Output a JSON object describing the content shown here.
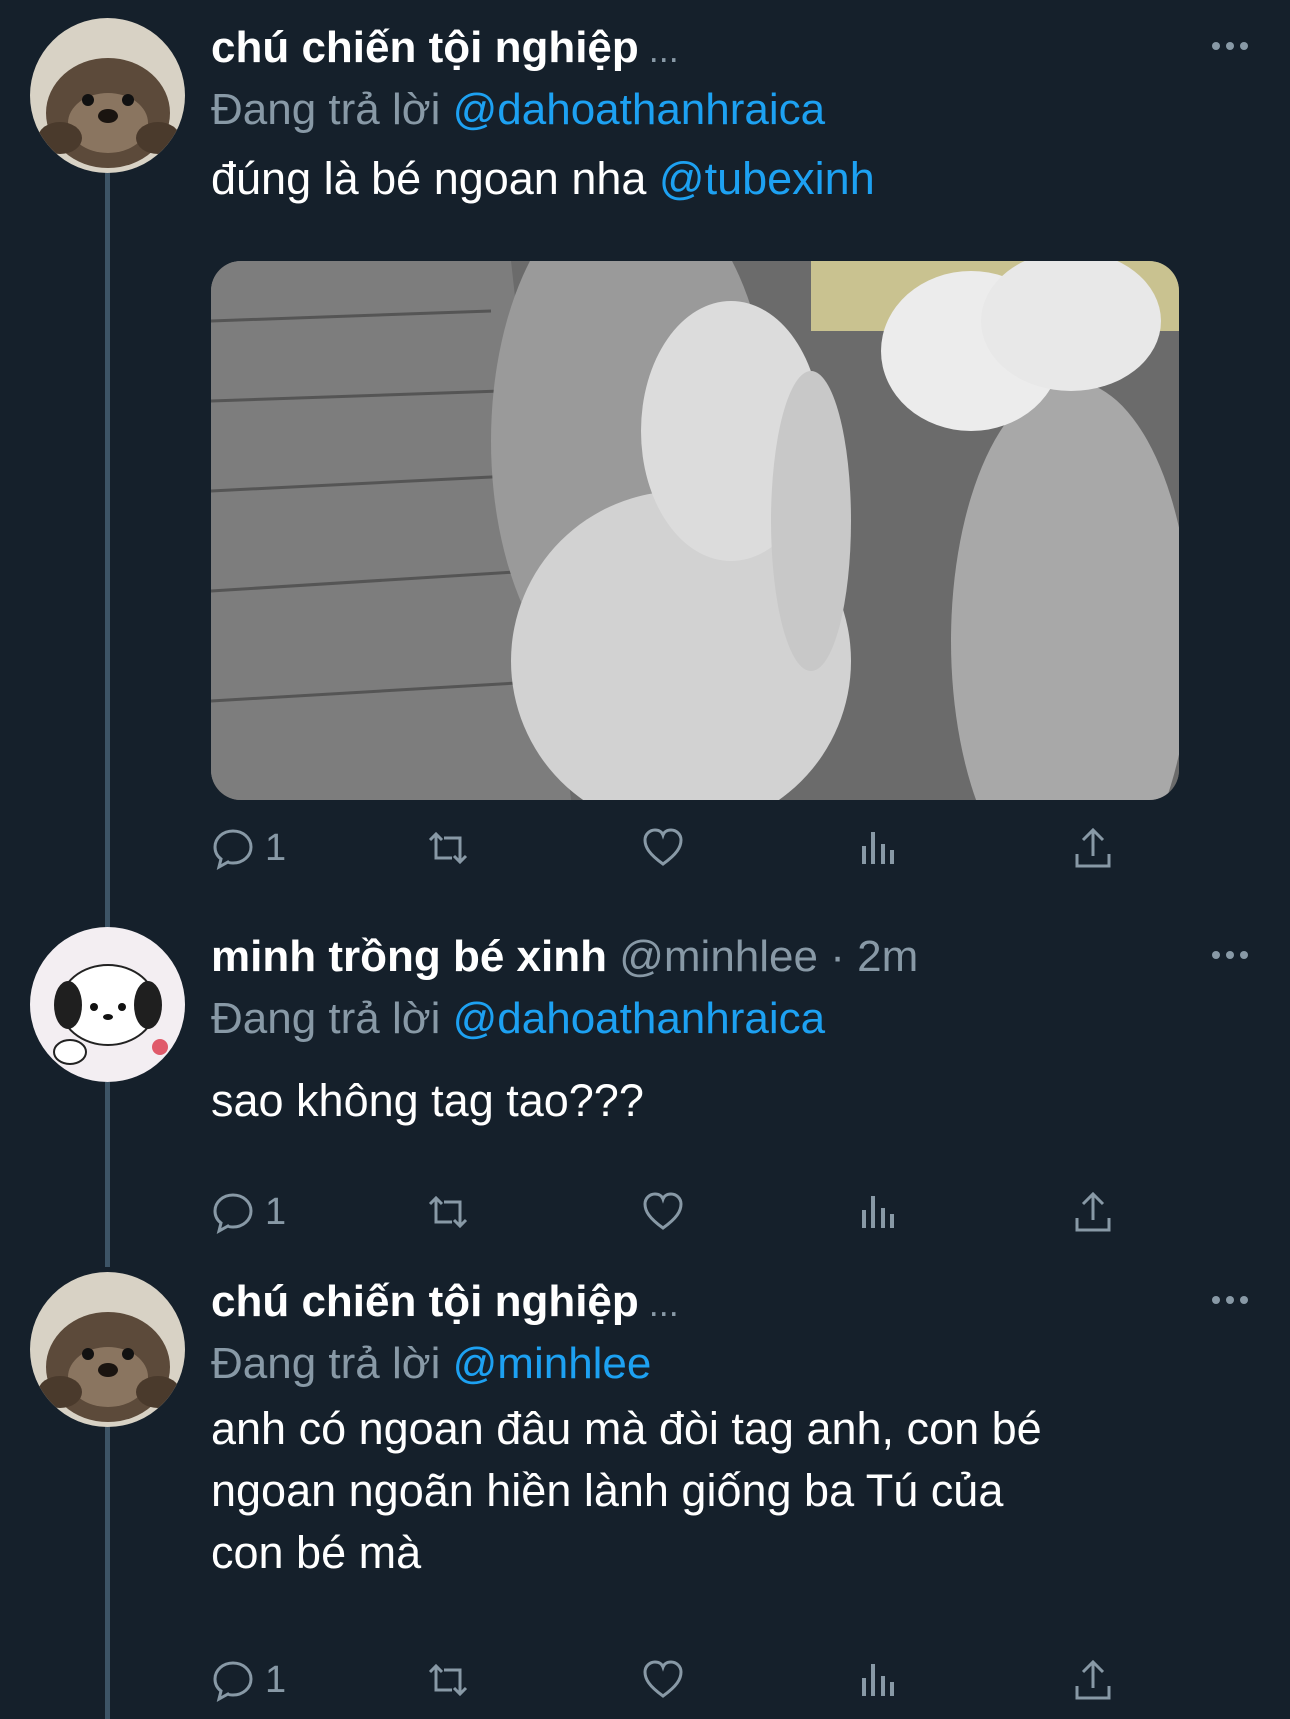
{
  "tweets": [
    {
      "name": "chú chiến tội nghiệp",
      "truncation": "...",
      "reply_prefix": "Đang trả lời",
      "reply_mention": "@dahoathanhraica",
      "text_parts": [
        "đúng là bé ngoan nha ",
        "@tubexinh"
      ],
      "has_media": true,
      "reply_count": "1",
      "avatar": "otter-avatar"
    },
    {
      "name": "minh trồng bé xinh",
      "handle": "@minhlee",
      "time": "· 2m",
      "reply_prefix": "Đang trả lời",
      "reply_mention": "@dahoathanhraica",
      "text": "sao không tag tao???",
      "reply_count": "1",
      "avatar": "pochacco-avatar"
    },
    {
      "name": "chú chiến tội nghiệp",
      "truncation": "...",
      "reply_prefix": "Đang trả lời",
      "reply_mention": "@minhlee",
      "text_lines": [
        "anh có ngoan đâu mà đòi tag anh, con bé",
        "ngoan ngoãn hiền lành giống ba Tú của",
        "con bé mà"
      ],
      "reply_count": "1",
      "avatar": "otter-avatar"
    }
  ],
  "icons": {
    "reply": "reply-icon",
    "retweet": "retweet-icon",
    "like": "like-icon",
    "analytics": "analytics-icon",
    "share": "share-icon",
    "more": "more-icon"
  },
  "colors": {
    "background": "#15202b",
    "mention": "#1da1f2",
    "secondary_text": "#8899a6",
    "thread_line": "#3d5466"
  }
}
